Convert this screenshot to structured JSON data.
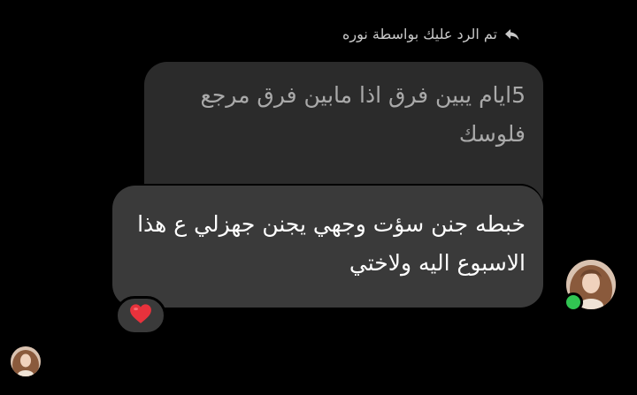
{
  "reply_header": {
    "text": "تم الرد عليك بواسطة نوره",
    "icon": "reply-arrow-icon"
  },
  "quoted_message": {
    "text": "5ايام يبين فرق اذا مابين فرق مرجع فلوسك"
  },
  "message": {
    "text": "خبطه جنن سؤت وجهي يجنن جهزلي ع هذا الاسبوع  اليه ولاختي"
  },
  "reaction": {
    "emoji": "❤️",
    "icon": "red-heart-icon",
    "color": "#e8323c"
  },
  "sender": {
    "avatar_icon": "user-avatar-photo",
    "online": true,
    "online_color": "#31c552"
  },
  "seen": {
    "avatar_icon": "seen-avatar-photo"
  },
  "colors": {
    "background": "#000000",
    "quoted_bubble": "#2b2b2b",
    "message_bubble": "#3a3a3a"
  }
}
